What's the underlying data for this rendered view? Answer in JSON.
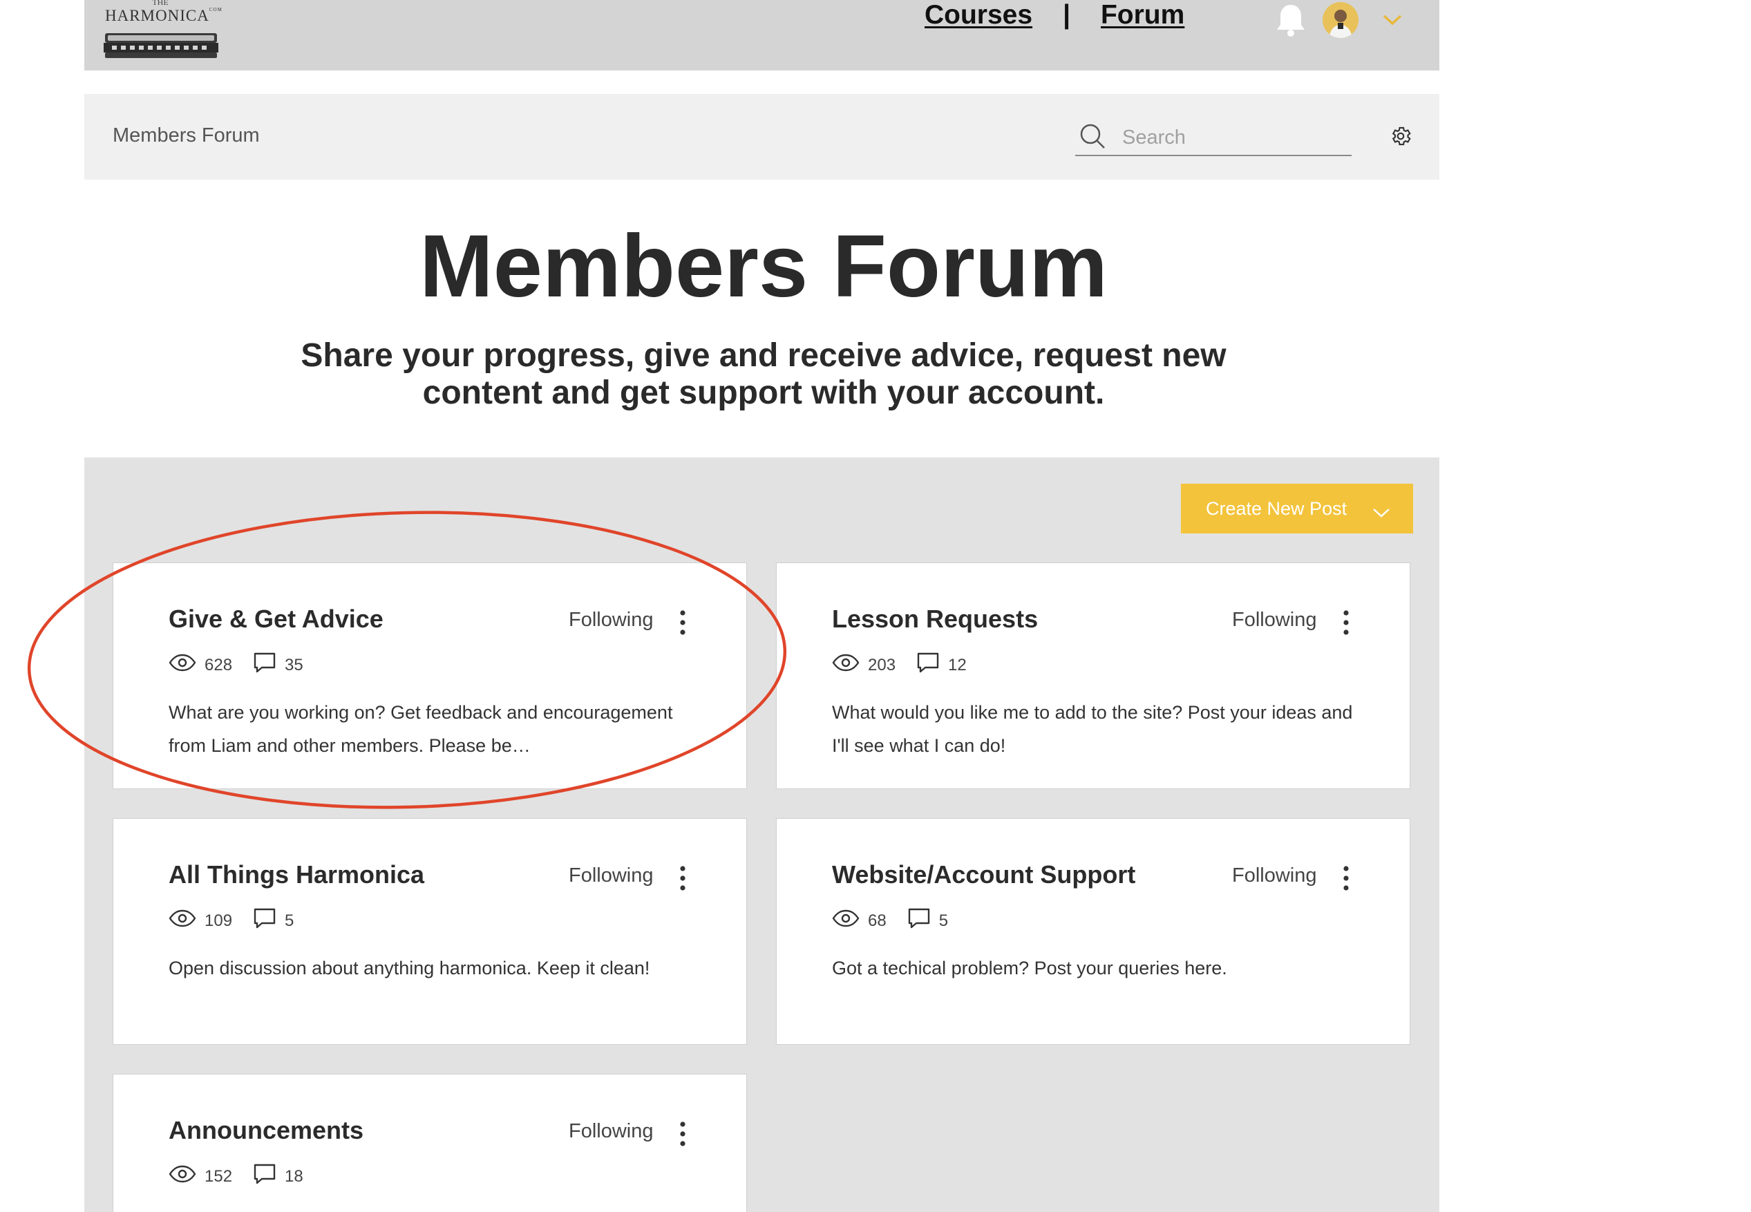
{
  "header": {
    "logo_the": "THE",
    "logo_brand": "HARMONICA",
    "logo_com": "COM",
    "nav": [
      {
        "label": "Courses"
      },
      {
        "label": "Forum"
      }
    ],
    "nav_separator": "|",
    "icons": [
      "bell-icon",
      "avatar",
      "chevron-down-icon"
    ],
    "accent_color": "#f3c33b"
  },
  "forum_bar": {
    "title": "Members Forum",
    "search_placeholder": "Search",
    "icons": [
      "search-icon",
      "gear-icon"
    ]
  },
  "hero": {
    "title": "Members Forum",
    "subtitle": "Share your progress, give and receive advice, request new content and get support with your account."
  },
  "actions": {
    "create_post_label": "Create New Post",
    "button_color": "#f3c33b"
  },
  "categories": [
    {
      "title": "Give & Get Advice",
      "follow_label": "Following",
      "views": "628",
      "comments": "35",
      "description": "What are you working on? Get feedback and encouragement from Liam and other members. Please be…"
    },
    {
      "title": "Lesson Requests",
      "follow_label": "Following",
      "views": "203",
      "comments": "12",
      "description": "What would you like me to add to the site? Post your ideas and I'll see what I can do!"
    },
    {
      "title": "All Things Harmonica",
      "follow_label": "Following",
      "views": "109",
      "comments": "5",
      "description": "Open discussion about anything harmonica. Keep it clean!"
    },
    {
      "title": "Website/Account Support",
      "follow_label": "Following",
      "views": "68",
      "comments": "5",
      "description": "Got a techical problem? Post your queries here."
    },
    {
      "title": "Announcements",
      "follow_label": "Following",
      "views": "152",
      "comments": "18",
      "description": ""
    }
  ],
  "annotation": {
    "shape": "ellipse",
    "color": "#e0452a",
    "target": "Give & Get Advice"
  }
}
